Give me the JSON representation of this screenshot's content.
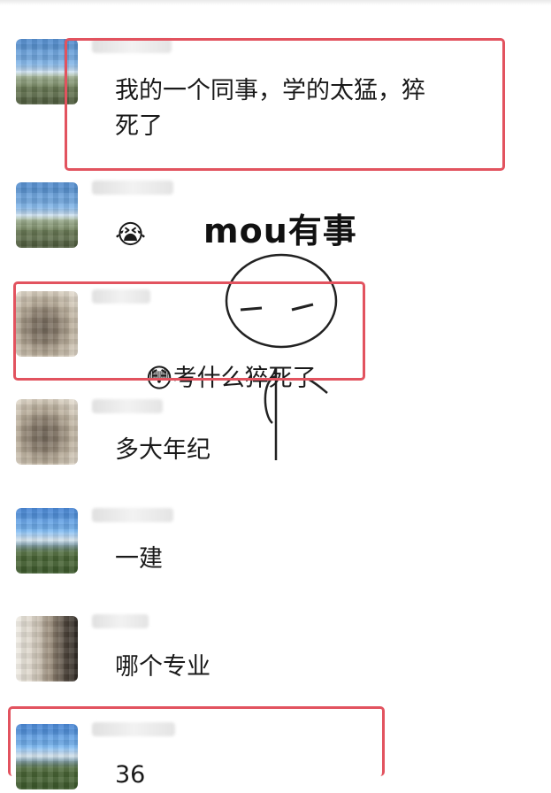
{
  "messages": [
    {
      "text": "我的一个同事，学的太猛，猝\n死了",
      "avatar_icon": "landscape-avatar-icon",
      "highlighted": true
    },
    {
      "text": "😭",
      "avatar_icon": "landscape-avatar-icon",
      "highlighted": false
    },
    {
      "text": "考什么猝死了",
      "emoji": "😳",
      "avatar_icon": "stone-avatar-icon",
      "highlighted": true
    },
    {
      "text": "多大年纪",
      "avatar_icon": "stone-avatar-icon",
      "highlighted": false
    },
    {
      "text": "一建",
      "avatar_icon": "castle-avatar-icon",
      "highlighted": false
    },
    {
      "text": "哪个专业",
      "avatar_icon": "statue-avatar-icon",
      "highlighted": false
    },
    {
      "text": "36",
      "avatar_icon": "castle-avatar-icon",
      "highlighted": true
    }
  ],
  "sticker": {
    "text": "mou有事",
    "icon": "stick-figure-sticker-icon"
  },
  "colors": {
    "highlight_box": "#e2535f",
    "background": "#ffffff",
    "text": "#1a1a1a"
  }
}
